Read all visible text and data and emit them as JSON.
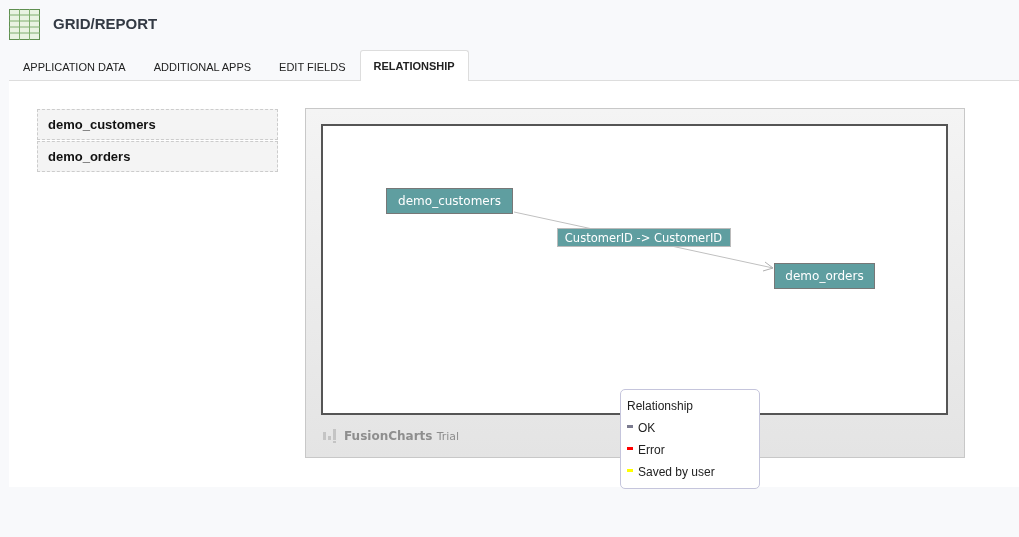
{
  "header": {
    "title": "GRID/REPORT"
  },
  "tabs": [
    {
      "label": "APPLICATION DATA",
      "selected": false
    },
    {
      "label": "ADDITIONAL APPS",
      "selected": false
    },
    {
      "label": "EDIT FIELDS",
      "selected": false
    },
    {
      "label": "RELATIONSHIP",
      "selected": true
    }
  ],
  "table_list": [
    "demo_customers",
    "demo_orders"
  ],
  "diagram": {
    "nodes": [
      "demo_customers",
      "demo_orders"
    ],
    "edges": [
      {
        "label": "CustomerID -> CustomerID"
      }
    ],
    "credit": {
      "brand": "FusionCharts",
      "note": "Trial"
    }
  },
  "legend": {
    "title": "Relationship",
    "items": [
      {
        "label": "OK",
        "color": "#7b7b8f"
      },
      {
        "label": "Error",
        "color": "#ff0000"
      },
      {
        "label": "Saved by user",
        "color": "#ffff00"
      }
    ]
  }
}
